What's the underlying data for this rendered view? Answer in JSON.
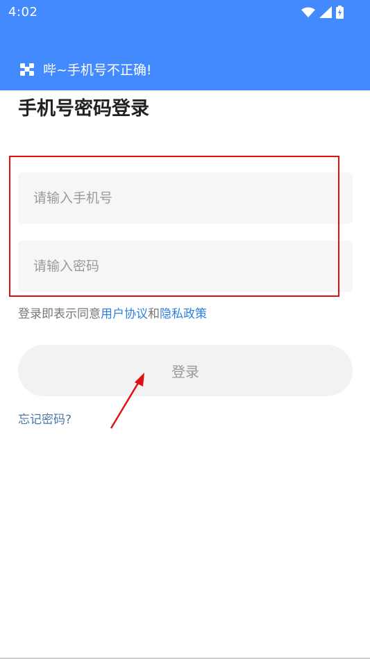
{
  "status_bar": {
    "time": "4:02",
    "icons": [
      "wifi-icon",
      "cellular-signal-icon",
      "battery-charging-icon"
    ]
  },
  "toast": {
    "icon": "app-logo-icon",
    "message": "哔~手机号不正确!"
  },
  "login": {
    "title": "手机号密码登录",
    "phone_placeholder": "请输入手机号",
    "password_placeholder": "请输入密码",
    "agreement_prefix": "登录即表示同意",
    "user_agreement_link": "用户协议",
    "agreement_and": "和",
    "privacy_policy_link": "隐私政策",
    "login_button_label": "登录",
    "forgot_password_link": "忘记密码?"
  },
  "annotations": {
    "highlight_color": "#e01010",
    "arrow_color": "#e01010"
  },
  "theme": {
    "banner_color": "#448aff",
    "link_color": "#2f7fe0"
  }
}
